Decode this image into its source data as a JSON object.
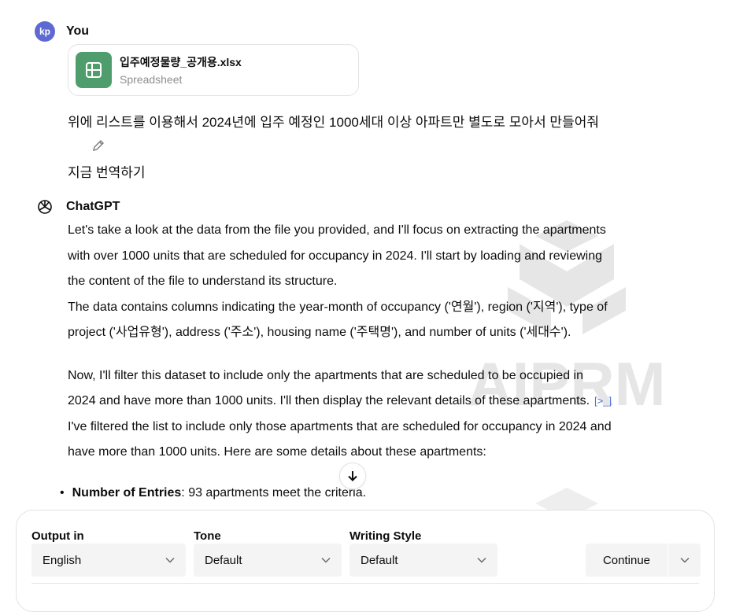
{
  "user": {
    "avatar_text": "kp",
    "author": "You",
    "attachment": {
      "name": "입주예정물량_공개용.xlsx",
      "type": "Spreadsheet"
    },
    "message": "위에 리스트를 이용해서 2024년에 입주 예정인 1000세대 이상 아파트만 별도로 모아서 만들어줘",
    "translate_label": "지금 번역하기"
  },
  "assistant": {
    "author": "ChatGPT",
    "lines": [
      "Let's take a look at the data from the file you provided, and I'll focus on extracting the apartments",
      "with over 1000 units that are scheduled for occupancy in 2024. I'll start by loading and reviewing",
      "the content of the file to understand its structure.",
      "The data contains columns indicating the year-month of occupancy ('연월'), region ('지역'), type of",
      "project ('사업유형'), address ('주소'), housing name ('주택명'), and number of units ('세대수').",
      "Now, I'll filter this dataset to include only the apartments that are scheduled to be occupied in",
      "2024 and have more than 1000 units. I'll then display the relevant details of these apartments.",
      "I've filtered the list to include only those apartments that are scheduled for occupancy in 2024 and",
      "have more than 1000 units. Here are some details about these apartments:"
    ],
    "code_icon": "[>_]",
    "bullet": {
      "label": "Number of Entries",
      "text": ": 93 apartments meet the criteria."
    }
  },
  "watermark_text": "AIPRM",
  "toolbar": {
    "output_label": "Output in",
    "output_value": "English",
    "tone_label": "Tone",
    "tone_value": "Default",
    "style_label": "Writing Style",
    "style_value": "Default",
    "continue_label": "Continue"
  },
  "colors": {
    "avatar": "#5e6ad2",
    "spreadsheet_icon": "#4f9d6d",
    "code_icon": "#4a6ee0",
    "select_bg": "#f4f4f4"
  },
  "icons": [
    "spreadsheet-icon",
    "pencil-icon",
    "openai-logo-icon",
    "code-interpreter-icon",
    "arrow-down-icon",
    "chevron-down-icon"
  ]
}
